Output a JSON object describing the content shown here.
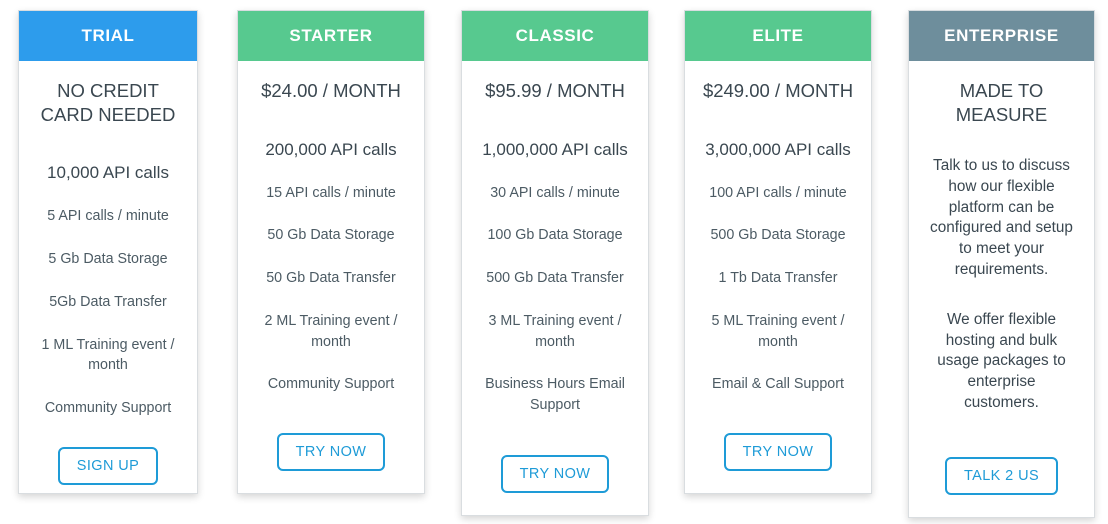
{
  "colors": {
    "trial_header": "#2D9CEC",
    "green_header": "#57C98F",
    "enterprise_header": "#6E8E9C",
    "cta_blue": "#1E9BD7",
    "body_text": "#3A4750",
    "feature_text": "#4C5B64",
    "card_border": "#D9DDE0"
  },
  "plans": [
    {
      "id": "trial",
      "name": "TRIAL",
      "price": "NO CREDIT CARD NEEDED",
      "quota": "10,000 API calls",
      "features": [
        "5 API calls / minute",
        "5 Gb Data Storage",
        "5Gb Data Transfer",
        "1 ML Training event / month",
        "Community Support"
      ],
      "cta": "SIGN UP"
    },
    {
      "id": "starter",
      "name": "STARTER",
      "price": "$24.00 / MONTH",
      "quota": "200,000 API calls",
      "features": [
        "15 API calls / minute",
        "50 Gb Data Storage",
        "50 Gb Data Transfer",
        "2 ML Training event / month",
        "Community Support"
      ],
      "cta": "TRY NOW"
    },
    {
      "id": "classic",
      "name": "CLASSIC",
      "price": "$95.99 / MONTH",
      "quota": "1,000,000 API calls",
      "features": [
        "30 API calls / minute",
        "100 Gb Data Storage",
        "500 Gb Data Transfer",
        "3 ML Training event / month",
        "Business Hours Email Support"
      ],
      "cta": "TRY NOW"
    },
    {
      "id": "elite",
      "name": "ELITE",
      "price": "$249.00 / MONTH",
      "quota": "3,000,000 API calls",
      "features": [
        "100 API calls / minute",
        "500 Gb Data Storage",
        "1 Tb Data Transfer",
        "5 ML Training event / month",
        "Email & Call Support"
      ],
      "cta": "TRY NOW"
    },
    {
      "id": "enterprise",
      "name": "ENTERPRISE",
      "price": "MADE TO MEASURE",
      "description_1": "Talk to us to discuss how our flexible platform can be configured and setup to meet your requirements.",
      "description_2": "We offer flexible hosting and bulk usage packages to enterprise customers.",
      "cta": "TALK 2 US"
    }
  ]
}
